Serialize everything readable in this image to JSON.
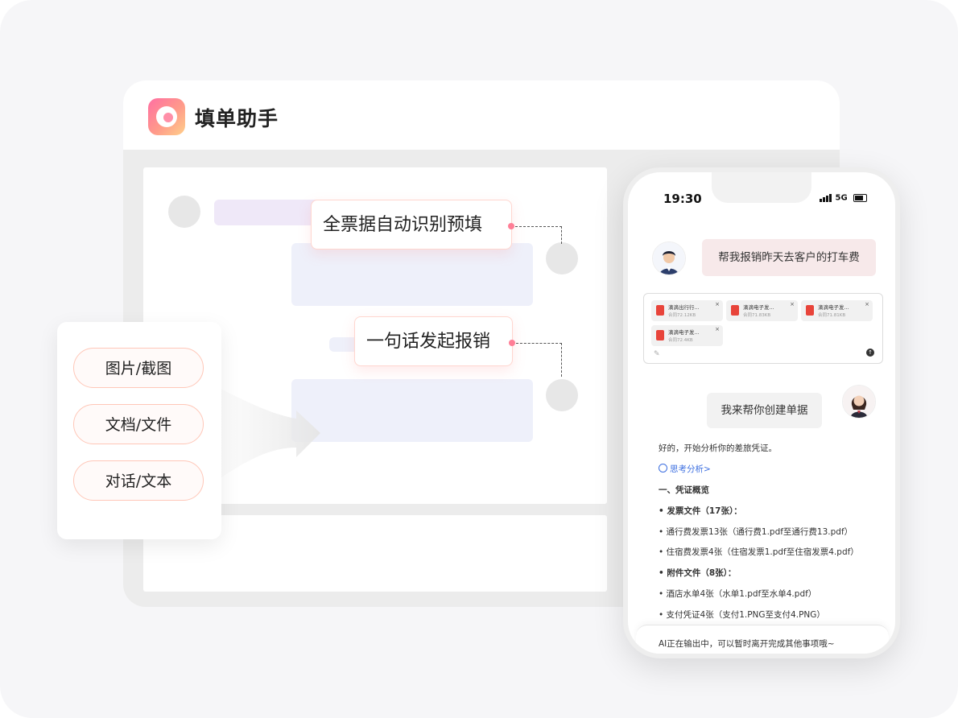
{
  "app": {
    "title": "填单助手"
  },
  "tags": {
    "auto_fill": "全票据自动识别预填",
    "one_sentence": "一句话发起报销"
  },
  "input_types": [
    "图片/截图",
    "文档/文件",
    "对话/文本"
  ],
  "phone": {
    "time": "19:30",
    "network": "5G",
    "user_message": "帮我报销昨天去客户的打车费",
    "attachments": [
      {
        "name": "滴滴出行行...",
        "size": "合同72.12KB"
      },
      {
        "name": "滴滴电子发...",
        "size": "合同71.83KB"
      },
      {
        "name": "滴滴电子发...",
        "size": "合同71.81KB"
      },
      {
        "name": "滴滴电子发...",
        "size": "合同72.4KB"
      }
    ],
    "ai_message": "我来帮你创建单据",
    "response": {
      "intro": "好的，开始分析你的差旅凭证。",
      "thinking": "思考分析>",
      "section_title": "一、凭证概览",
      "invoice_heading": "• 发票文件（17张）：",
      "invoice_item1": "• 通行费发票13张（通行费1.pdf至通行费13.pdf）",
      "invoice_item2": "• 住宿费发票4张（住宿发票1.pdf至住宿发票4.pdf）",
      "attachment_heading": "• 附件文件（8张）：",
      "attachment_item1": "• 酒店水单4张（水单1.pdf至水单4.pdf）",
      "attachment_item2": "• 支付凭证4张（支付1.PNG至支付4.PNG）"
    },
    "status_message": "AI正在输出中，可以暂时离开完成其他事项哦~"
  },
  "colors": {
    "accent_pink": "#ff7e96",
    "link_blue": "#3d6fe0"
  }
}
